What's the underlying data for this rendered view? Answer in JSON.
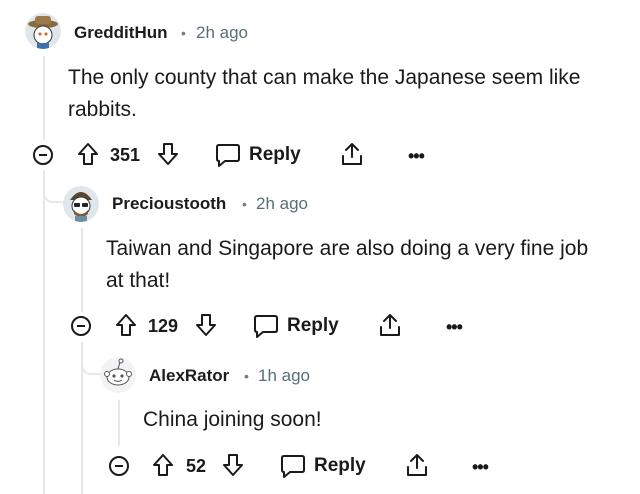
{
  "comments": [
    {
      "author": "GredditHun",
      "dot": "•",
      "time": "2h ago",
      "body_lines": [
        "The only county that can make the Japanese seem like",
        "rabbits."
      ],
      "score": "351",
      "reply_label": "Reply",
      "more_label": "•••"
    },
    {
      "author": "Precioustooth",
      "dot": "•",
      "time": "2h ago",
      "body_lines": [
        "Taiwan and Singapore are also doing a very fine job",
        "at that!"
      ],
      "score": "129",
      "reply_label": "Reply",
      "more_label": "•••"
    },
    {
      "author": "AlexRator",
      "dot": "•",
      "time": "1h ago",
      "body_lines": [
        "China joining soon!"
      ],
      "score": "52",
      "reply_label": "Reply",
      "more_label": "•••"
    }
  ],
  "colors": {
    "thread_line": "#e5e7eb",
    "meta": "#576f76",
    "text": "#1a1a1b"
  }
}
